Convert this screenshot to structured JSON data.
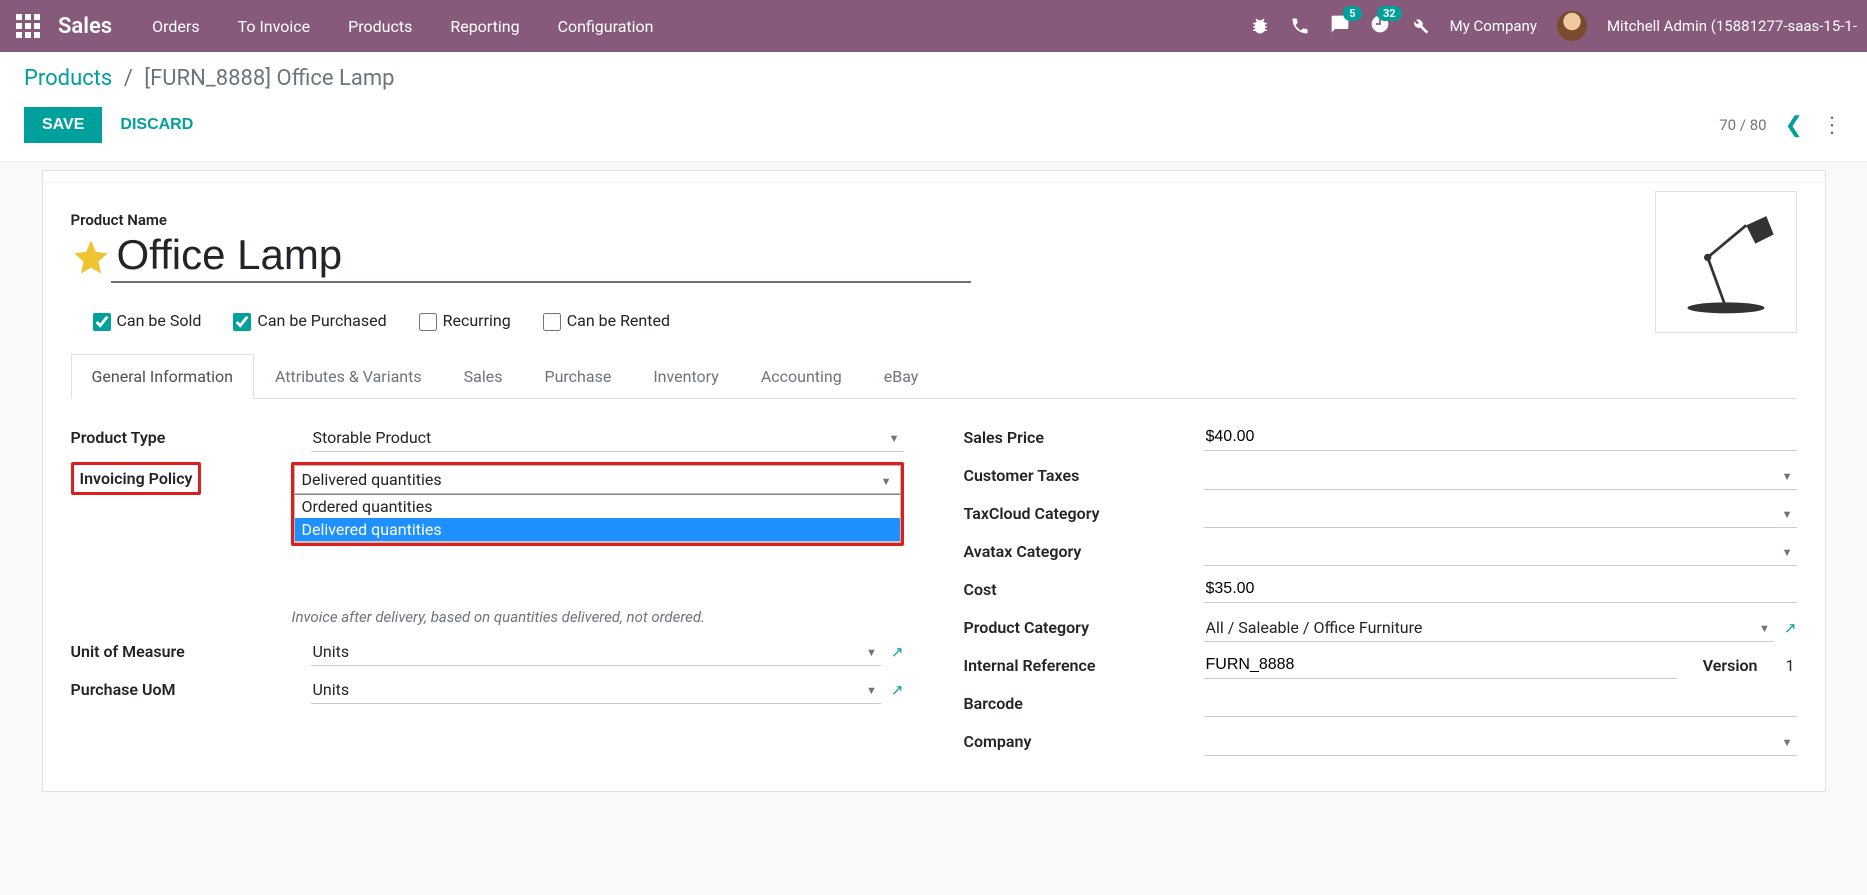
{
  "nav": {
    "brand": "Sales",
    "links": [
      "Orders",
      "To Invoice",
      "Products",
      "Reporting",
      "Configuration"
    ],
    "chat_badge": "5",
    "clock_badge": "32",
    "company": "My Company",
    "user": "Mitchell Admin (15881277-saas-15-1-"
  },
  "breadcrumb": {
    "parent": "Products",
    "current": "[FURN_8888] Office Lamp"
  },
  "actions": {
    "save": "SAVE",
    "discard": "DISCARD"
  },
  "pager": {
    "text": "70 / 80"
  },
  "product": {
    "label": "Product Name",
    "name": "Office Lamp",
    "checks": {
      "sold": "Can be Sold",
      "purchased": "Can be Purchased",
      "recurring": "Recurring",
      "rented": "Can be Rented"
    }
  },
  "tabs": [
    "General Information",
    "Attributes & Variants",
    "Sales",
    "Purchase",
    "Inventory",
    "Accounting",
    "eBay"
  ],
  "left": {
    "product_type": {
      "label": "Product Type",
      "value": "Storable Product"
    },
    "invoicing_policy": {
      "label": "Invoicing Policy",
      "value": "Delivered quantities",
      "options": [
        "Ordered quantities",
        "Delivered quantities"
      ],
      "help": "Invoice after delivery, based on quantities delivered, not ordered."
    },
    "uom": {
      "label": "Unit of Measure",
      "value": "Units"
    },
    "purchase_uom": {
      "label": "Purchase UoM",
      "value": "Units"
    }
  },
  "right": {
    "sales_price": {
      "label": "Sales Price",
      "value": "$40.00"
    },
    "customer_taxes": {
      "label": "Customer Taxes",
      "value": ""
    },
    "taxcloud": {
      "label": "TaxCloud Category",
      "value": ""
    },
    "avatax": {
      "label": "Avatax Category",
      "value": ""
    },
    "cost": {
      "label": "Cost",
      "value": "$35.00"
    },
    "category": {
      "label": "Product Category",
      "value": "All / Saleable / Office Furniture"
    },
    "internal_ref": {
      "label": "Internal Reference",
      "value": "FURN_8888"
    },
    "version": {
      "label": "Version",
      "value": "1"
    },
    "barcode": {
      "label": "Barcode",
      "value": ""
    },
    "company": {
      "label": "Company",
      "value": ""
    }
  }
}
